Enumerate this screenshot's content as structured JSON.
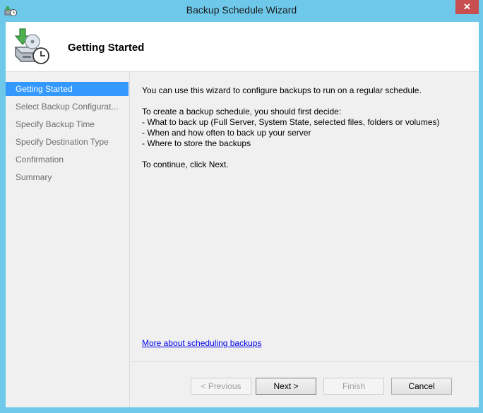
{
  "window": {
    "title": "Backup Schedule Wizard",
    "close_glyph": "✕",
    "app_icon": "backup-clock-icon"
  },
  "header": {
    "title": "Getting Started",
    "icon": "backup-schedule-icon"
  },
  "nav": {
    "items": [
      {
        "label": "Getting Started",
        "active": true
      },
      {
        "label": "Select Backup Configurat...",
        "active": false
      },
      {
        "label": "Specify Backup Time",
        "active": false
      },
      {
        "label": "Specify Destination Type",
        "active": false
      },
      {
        "label": "Confirmation",
        "active": false
      },
      {
        "label": "Summary",
        "active": false
      }
    ]
  },
  "content": {
    "intro": "You can use this wizard to configure backups to run on a regular schedule.",
    "decide": "To create a backup schedule, you should first decide:",
    "bullets": [
      "-  What to back up (Full Server, System State, selected files, folders or volumes)",
      "-  When and how often to back up your server",
      "-  Where to store the backups"
    ],
    "continue": "To continue, click Next.",
    "help_link": "More about scheduling backups"
  },
  "buttons": {
    "previous": "< Previous",
    "next": "Next >",
    "finish": "Finish",
    "cancel": "Cancel"
  },
  "colors": {
    "frame": "#6ec8ea",
    "close": "#c74f4f",
    "selection": "#3399ff",
    "link": "#0000ee"
  }
}
